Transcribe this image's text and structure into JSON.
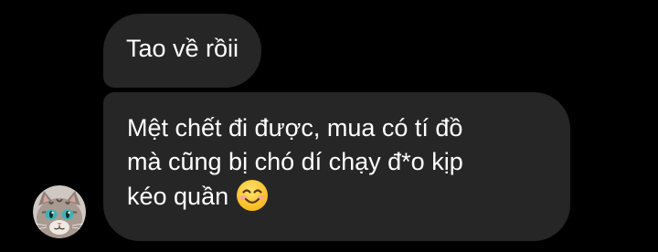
{
  "messages": [
    {
      "lines": [
        "Tao về rồii"
      ]
    },
    {
      "lines": [
        "Mệt chết đi được, mua có tí đồ",
        "mà cũng bị chó dí chạy đ*o kịp",
        "kéo quần"
      ],
      "emoji": "smiling-face-emoji"
    }
  ],
  "sender": {
    "avatar_icon": "cat-avatar"
  },
  "colors": {
    "background": "#000000",
    "bubble": "#262626",
    "text": "#ffffff"
  }
}
